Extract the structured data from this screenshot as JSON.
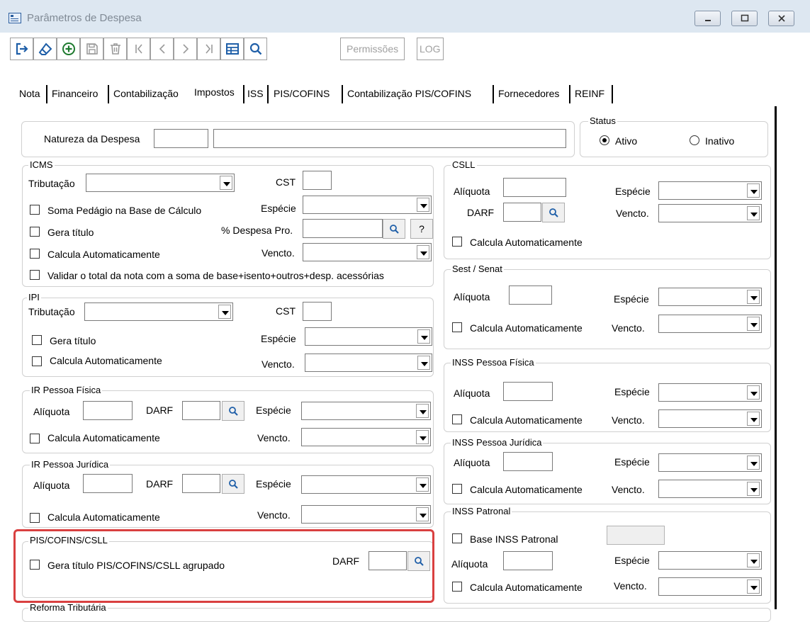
{
  "window": {
    "title": "Parâmetros de Despesa"
  },
  "toolbar": {
    "permissions_label": "Permissões",
    "log_label": "LOG"
  },
  "tabs": [
    "Nota",
    "Financeiro",
    "Contabilização",
    "Impostos",
    "ISS",
    "PIS/COFINS",
    "Contabilização PIS/COFINS",
    "Fornecedores",
    "REINF"
  ],
  "natureza": {
    "label": "Natureza da Despesa",
    "code": "",
    "description": ""
  },
  "status": {
    "title": "Status",
    "ativo": "Ativo",
    "inativo": "Inativo",
    "selected": "Ativo"
  },
  "icms": {
    "title": "ICMS",
    "tributacao_label": "Tributação",
    "cst_label": "CST",
    "soma_pedagio": "Soma Pedágio na Base de Cálculo",
    "especie_label": "Espécie",
    "gera_titulo": "Gera título",
    "despesa_pro_label": "% Despesa Pro.",
    "calcula_auto": "Calcula Automaticamente",
    "vencto_label": "Vencto.",
    "validar": "Validar o total da nota com a soma de base+isento+outros+desp. acessórias",
    "help_label": "?"
  },
  "ipi": {
    "title": "IPI",
    "tributacao_label": "Tributação",
    "cst_label": "CST",
    "gera_titulo": "Gera título",
    "especie_label": "Espécie",
    "calcula_auto": "Calcula Automaticamente",
    "vencto_label": "Vencto."
  },
  "ir_pf": {
    "title": "IR Pessoa Física",
    "aliquota_label": "Alíquota",
    "darf_label": "DARF",
    "especie_label": "Espécie",
    "calcula_auto": "Calcula Automaticamente",
    "vencto_label": "Vencto."
  },
  "ir_pj": {
    "title": "IR Pessoa Jurídica",
    "aliquota_label": "Alíquota",
    "darf_label": "DARF",
    "especie_label": "Espécie",
    "calcula_auto": "Calcula Automaticamente",
    "vencto_label": "Vencto."
  },
  "pis_cofins_csll": {
    "title": "PIS/COFINS/CSLL",
    "gera_titulo": "Gera título PIS/COFINS/CSLL agrupado",
    "darf_label": "DARF"
  },
  "reforma": {
    "title": "Reforma Tributária"
  },
  "csll": {
    "title": "CSLL",
    "aliquota_label": "Alíquota",
    "especie_label": "Espécie",
    "darf_label": "DARF",
    "vencto_label": "Vencto.",
    "calcula_auto": "Calcula Automaticamente"
  },
  "sest": {
    "title": "Sest / Senat",
    "aliquota_label": "Alíquota",
    "especie_label": "Espécie",
    "calcula_auto": "Calcula Automaticamente",
    "vencto_label": "Vencto."
  },
  "inss_pf": {
    "title": "INSS Pessoa Física",
    "aliquota_label": "Alíquota",
    "especie_label": "Espécie",
    "calcula_auto": "Calcula Automaticamente",
    "vencto_label": "Vencto."
  },
  "inss_pj": {
    "title": "INSS Pessoa Jurídica",
    "aliquota_label": "Alíquota",
    "especie_label": "Espécie",
    "calcula_auto": "Calcula Automaticamente",
    "vencto_label": "Vencto."
  },
  "inss_patronal": {
    "title": "INSS Patronal",
    "base_label": "Base INSS Patronal",
    "aliquota_label": "Alíquota",
    "especie_label": "Espécie",
    "calcula_auto": "Calcula Automaticamente",
    "vencto_label": "Vencto."
  },
  "colors": {
    "highlight": "#d94040",
    "titlebar": "#dde7f1",
    "icon_blue": "#1f5fa8",
    "icon_green": "#1d7a2e"
  }
}
